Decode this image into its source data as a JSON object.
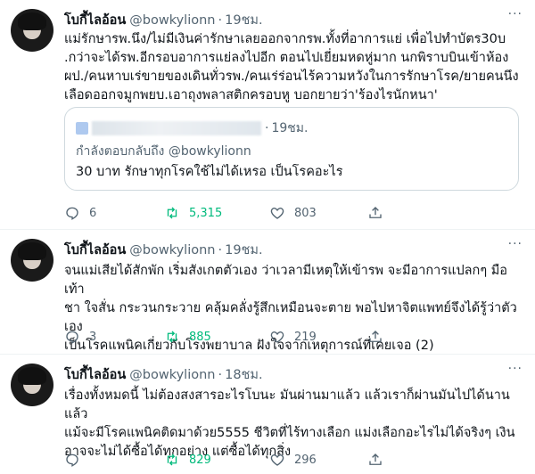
{
  "colors": {
    "text": "#0f1419",
    "muted": "#536471",
    "retweet": "#00ba7c",
    "border": "#cfd9de"
  },
  "tweets": [
    {
      "name": "โบกี้ไลอ้อน",
      "handle": "@bowkylionn",
      "dot": "·",
      "time": "19ชม.",
      "more": "···",
      "text": "แม่รักษารพ.นึง/ไม่มีเงินค่ารักษาเลยออกจากรพ.ทั้งที่อาการแย่ เพื่อไปทำบัตร30บ\n.กว่าจะได้รพ.อีกรอบอาการแย่ลงไปอีก ตอนไปเยี่ยมหดหู่มาก นกพิราบบินเข้าห้อง\nผป./คนหาบเร่ขายของเดินทั่วรพ./คนเร่ร่อนไร้ความหวังในการรักษาโรค/ยายคนนึง\nเลือดออกจมูกพยบ.เอาถุงพลาสติกครอบหู บอกยายว่า'ร้องไรนักหนา'",
      "quote": {
        "dot": "·",
        "time": "19ชม.",
        "reply_prefix": "กำลังตอบกลับถึง",
        "reply_handle": "@bowkylionn",
        "text": "30 บาท รักษาทุกโรคใช้ไม่ได้เหรอ เป็นโรคอะไร"
      },
      "counts": {
        "reply": "6",
        "retweet": "5,315",
        "like": "803"
      }
    },
    {
      "name": "โบกี้ไลอ้อน",
      "handle": "@bowkylionn",
      "dot": "·",
      "time": "19ชม.",
      "more": "···",
      "text": "จนแม่เสียได้สักพัก เริ่มสังเกตตัวเอง ว่าเวลามีเหตุให้เข้ารพ จะมีอาการแปลกๆ มือเท้า\nชา ใจสั่น กระวนกระวาย คลุ้มคลั่งรู้สึกเหมือนจะตาย พอไปหาจิตแพทย์จึงได้รู้ว่าตัวเอง\nเป็นโรคแพนิคเกี่ยวกับโรงพยาบาล ฝังใจจากเหตุการณ์ที่เคยเจอ (2)",
      "counts": {
        "reply": "3",
        "retweet": "885",
        "like": "219"
      }
    },
    {
      "name": "โบกี้ไลอ้อน",
      "handle": "@bowkylionn",
      "dot": "·",
      "time": "18ชม.",
      "more": "···",
      "text": "เรื่องทั้งหมดนี้ ไม่ต้องสงสารอะไรโบนะ มันผ่านมาแล้ว แล้วเราก็ผ่านมันไปได้นานแล้ว\nแม้จะมีโรคแพนิคติดมาด้วย5555 ชีวิตที่ไร้ทางเลือก แม่งเลือกอะไรไม่ได้จริงๆ เงิน\nอาจจะไม่ได้ซื้อได้ทุกอย่าง แต่ซื้อได้ทุกสิ่ง",
      "counts": {
        "reply": "",
        "retweet": "829",
        "like": "296"
      }
    }
  ]
}
